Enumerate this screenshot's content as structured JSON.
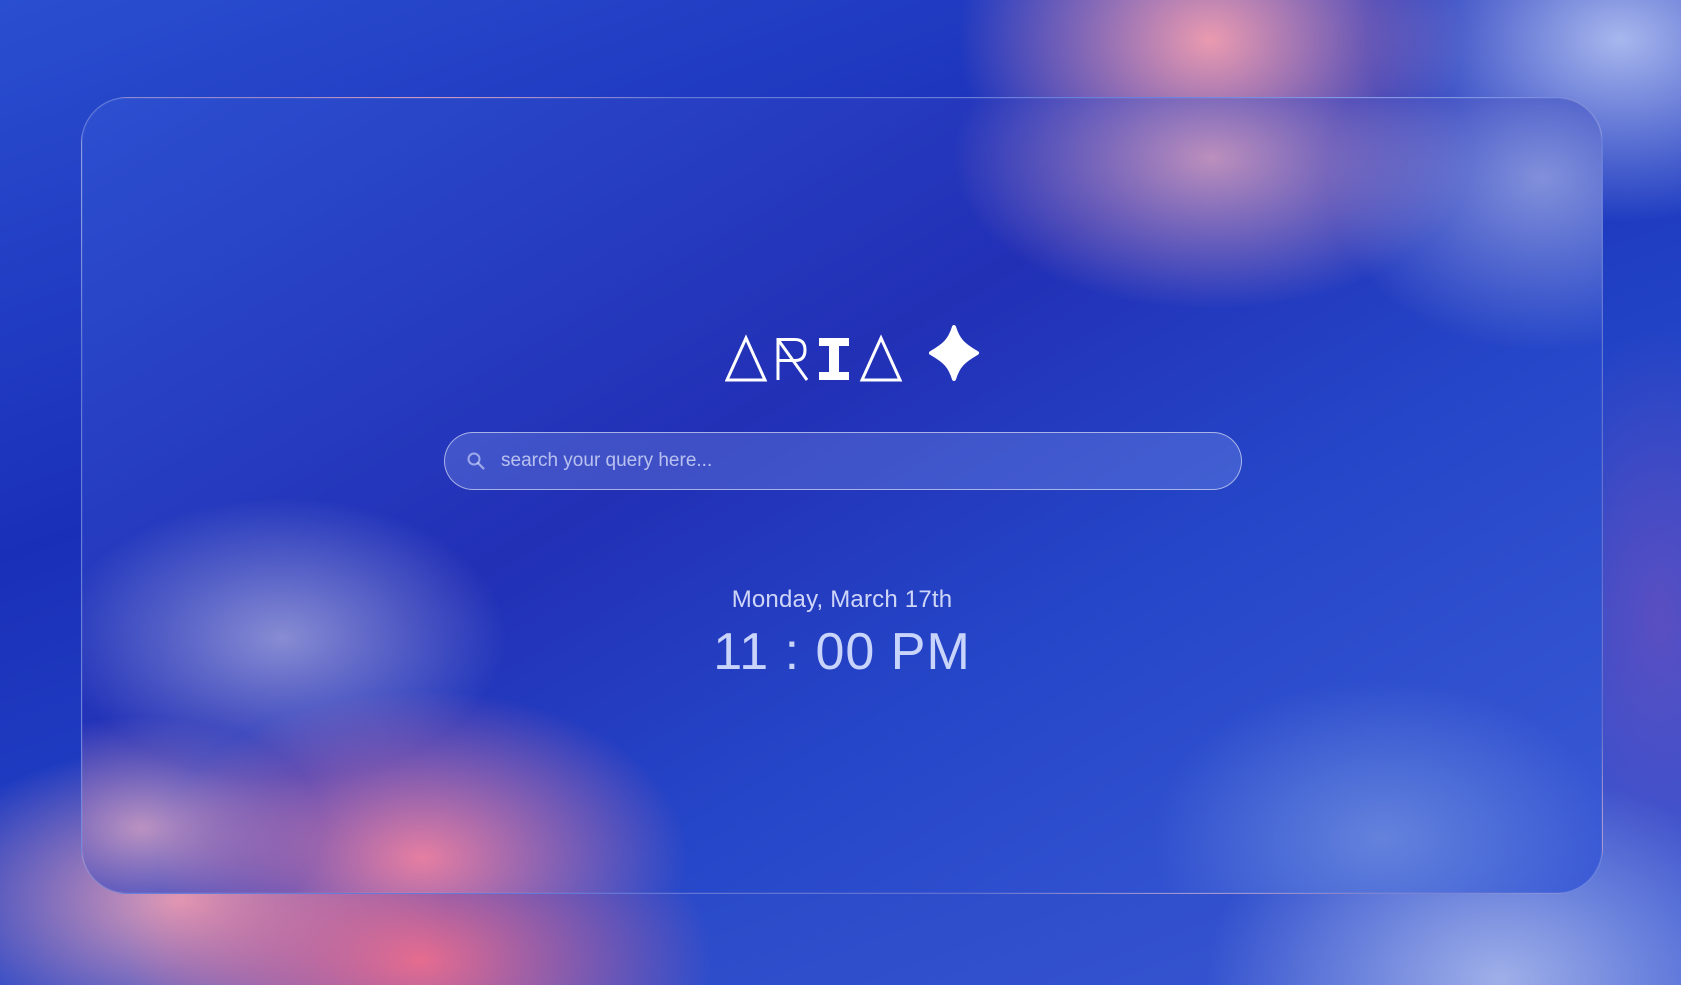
{
  "brand": {
    "name": "ARIA",
    "icon": "sparkle-icon",
    "color": "#ffffff"
  },
  "search": {
    "placeholder": "search your query here...",
    "value": "",
    "icon": "search-icon"
  },
  "clock": {
    "date": "Monday, March 17th",
    "time": "11 : 00 PM"
  },
  "colors": {
    "background_primary": "#2230b6",
    "background_accent_pink": "#f06e8c",
    "background_accent_lavender": "#afbef0",
    "text_light": "#e6ebff"
  }
}
